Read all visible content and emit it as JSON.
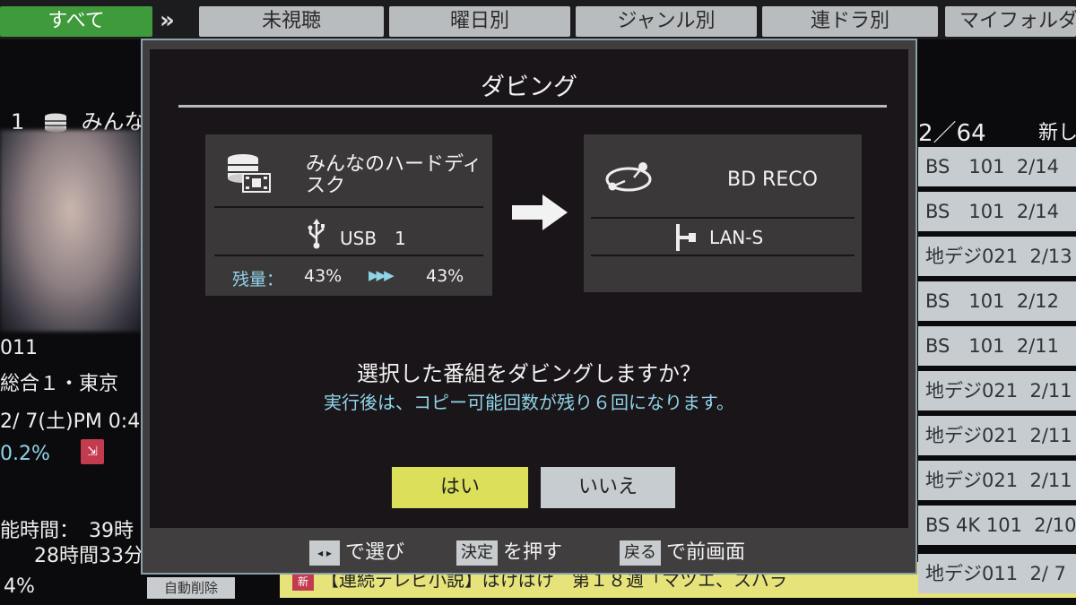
{
  "background": {
    "tabs": [
      {
        "label": "すべて",
        "active": true
      },
      {
        "label": "未視聴"
      },
      {
        "label": "曜日別"
      },
      {
        "label": "ジャンル別"
      },
      {
        "label": "連ドラ別"
      },
      {
        "label": "マイフォルダ"
      }
    ],
    "tab_scroll_icon": "»",
    "selected_index": "1",
    "selected_title": "みんな",
    "info_lines": [
      "011",
      "総合１・東京",
      "2/ 7(土)PM 0:4",
      "0.2%",
      "能時間：　39時",
      "28時間33分"
    ],
    "count": "2／64",
    "newest_label": "新し",
    "list_rows": [
      {
        "ch": "BS　101",
        "date": "2/14"
      },
      {
        "ch": "BS　101",
        "date": "2/14"
      },
      {
        "ch": "地デジ021",
        "date": "2/13"
      },
      {
        "ch": "BS　101",
        "date": "2/12"
      },
      {
        "ch": "BS　101",
        "date": "2/11"
      },
      {
        "ch": "地デジ021",
        "date": "2/11"
      },
      {
        "ch": "地デジ021",
        "date": "2/11"
      },
      {
        "ch": "地デジ021",
        "date": "2/11"
      },
      {
        "ch": "BS 4K 101",
        "date": "2/10"
      }
    ],
    "bottom_list": {
      "ch": "地デジ011",
      "date": "2/ 7"
    },
    "bottom_program": "【連続テレビ小説】ばけばけ　第１８週「マツエ、スバラ",
    "bottom_tag": "新",
    "auto_delete": "自動削除",
    "bottom_percent": "4%"
  },
  "dialog": {
    "title": "ダビング",
    "source": {
      "name": "みんなのハードディスク",
      "port": "USB　1",
      "remaining_label": "残量：",
      "remaining_before": "43%",
      "remaining_after": "43%"
    },
    "destination": {
      "name": "BD RECO",
      "connection": "LAN-S"
    },
    "question": "選択した番組をダビングしますか？",
    "note": "実行後は、コピー可能回数が残り６回になります。",
    "buttons": {
      "yes": "はい",
      "no": "いいえ"
    },
    "hints": {
      "select_key": "◂ ▸",
      "select_text": "で選び",
      "confirm_key": "決定",
      "confirm_text": "を押す",
      "back_key": "戻る",
      "back_text": "で前画面"
    }
  },
  "colors": {
    "yes_button": "#dbdf5a",
    "no_button": "#c6ccd0",
    "accent_cyan": "#8fd4e8",
    "active_tab": "#3f9a3c"
  }
}
